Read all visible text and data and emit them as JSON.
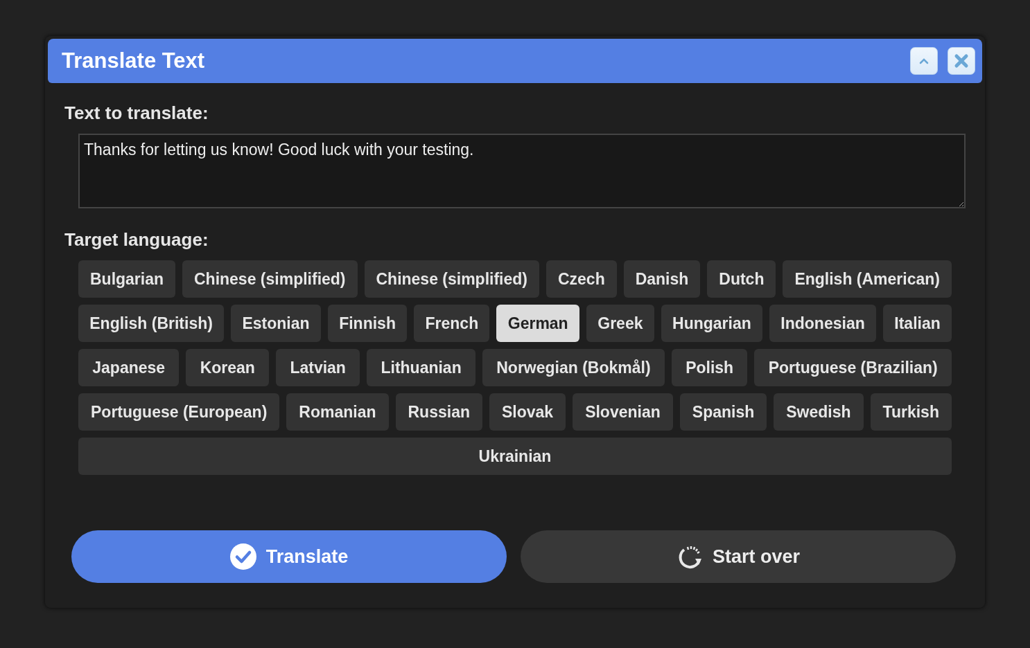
{
  "window": {
    "title": "Translate Text"
  },
  "text_field": {
    "label": "Text to translate:",
    "value": "Thanks for letting us know! Good luck with your testing."
  },
  "languages": {
    "label": "Target language:",
    "items": [
      {
        "label": "Bulgarian",
        "selected": false
      },
      {
        "label": "Chinese (simplified)",
        "selected": false
      },
      {
        "label": "Chinese (simplified)",
        "selected": false
      },
      {
        "label": "Czech",
        "selected": false
      },
      {
        "label": "Danish",
        "selected": false
      },
      {
        "label": "Dutch",
        "selected": false
      },
      {
        "label": "English (American)",
        "selected": false
      },
      {
        "label": "English (British)",
        "selected": false
      },
      {
        "label": "Estonian",
        "selected": false
      },
      {
        "label": "Finnish",
        "selected": false
      },
      {
        "label": "French",
        "selected": false
      },
      {
        "label": "German",
        "selected": true
      },
      {
        "label": "Greek",
        "selected": false
      },
      {
        "label": "Hungarian",
        "selected": false
      },
      {
        "label": "Indonesian",
        "selected": false
      },
      {
        "label": "Italian",
        "selected": false
      },
      {
        "label": "Japanese",
        "selected": false
      },
      {
        "label": "Korean",
        "selected": false
      },
      {
        "label": "Latvian",
        "selected": false
      },
      {
        "label": "Lithuanian",
        "selected": false
      },
      {
        "label": "Norwegian (Bokmål)",
        "selected": false
      },
      {
        "label": "Polish",
        "selected": false
      },
      {
        "label": "Portuguese (Brazilian)",
        "selected": false
      },
      {
        "label": "Portuguese (European)",
        "selected": false
      },
      {
        "label": "Romanian",
        "selected": false
      },
      {
        "label": "Russian",
        "selected": false
      },
      {
        "label": "Slovak",
        "selected": false
      },
      {
        "label": "Slovenian",
        "selected": false
      },
      {
        "label": "Spanish",
        "selected": false
      },
      {
        "label": "Swedish",
        "selected": false
      },
      {
        "label": "Turkish",
        "selected": false
      },
      {
        "label": "Ukrainian",
        "selected": false
      }
    ]
  },
  "buttons": [
    {
      "label": "Translate",
      "kind": "primary"
    },
    {
      "label": "Start over",
      "kind": "secondary"
    }
  ]
}
